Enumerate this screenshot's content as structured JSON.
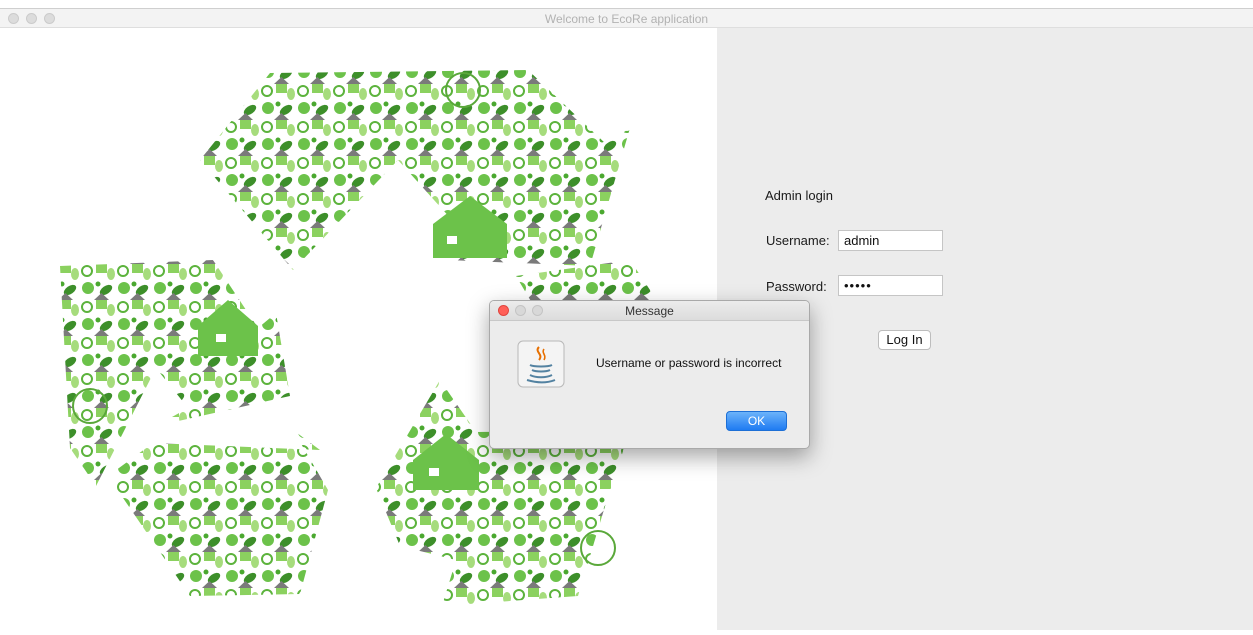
{
  "window": {
    "title": "Welcome to EcoRe application"
  },
  "login": {
    "heading": "Admin login",
    "username_label": "Username:",
    "username_value": "admin",
    "password_label": "Password:",
    "password_value": "•••••",
    "login_button": "Log In"
  },
  "dialog": {
    "title": "Message",
    "message": "Username or password is incorrect",
    "ok_button": "OK",
    "icon": "java-icon"
  },
  "illustration": {
    "icon": "recycle-symbol-icon",
    "color": "#6cc24a"
  },
  "colors": {
    "accent_green": "#6cc24a",
    "dark_green": "#3d8f2a",
    "ok_button_blue": "#2f86f5",
    "close_red": "#ff5f57",
    "right_panel_bg": "#ececec"
  }
}
